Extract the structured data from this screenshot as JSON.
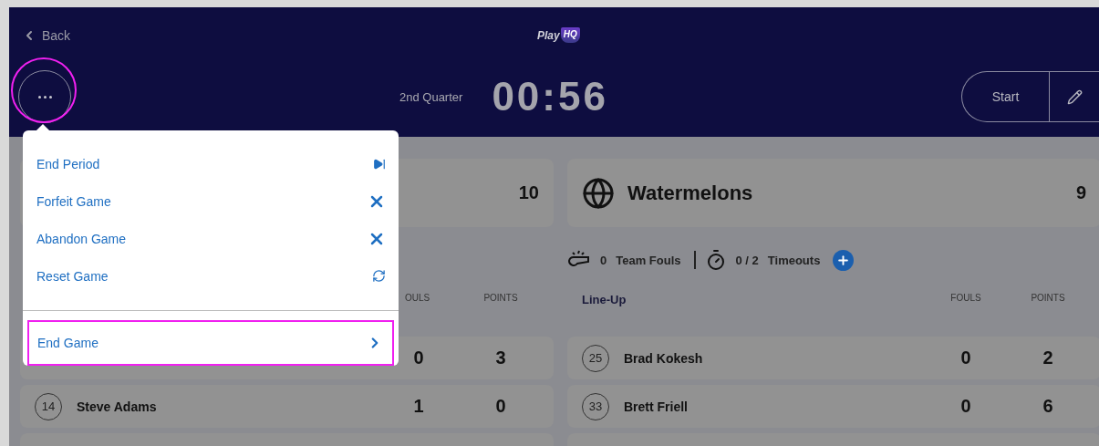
{
  "header": {
    "back": "Back",
    "logo": "Play",
    "logo_badge": "HQ",
    "period": "2nd Quarter",
    "clock": "00:56",
    "start": "Start"
  },
  "menu": {
    "items": [
      {
        "label": "End Period",
        "kind": "skip"
      },
      {
        "label": "Forfeit Game",
        "kind": "close"
      },
      {
        "label": "Abandon Game",
        "kind": "close"
      },
      {
        "label": "Reset Game",
        "kind": "reset"
      }
    ],
    "footer": {
      "label": "End Game",
      "kind": "next"
    }
  },
  "home": {
    "score": "10",
    "columns": [
      "OULS",
      "POINTS"
    ],
    "rows": [
      {
        "fouls": "0",
        "points": "3"
      },
      {
        "number": "14",
        "name": "Steve Adams",
        "fouls": "1",
        "points": "0"
      }
    ]
  },
  "away": {
    "name": "Watermelons",
    "score": "9",
    "fouls": "0",
    "fouls_label": "Team Fouls",
    "timeouts": "0 / 2",
    "timeouts_label": "Timeouts",
    "title": "Line-Up",
    "columns": [
      "FOULS",
      "POINTS"
    ],
    "rows": [
      {
        "number": "25",
        "name": "Brad Kokesh",
        "fouls": "0",
        "points": "2"
      },
      {
        "number": "33",
        "name": "Brett Friell",
        "fouls": "0",
        "points": "6"
      }
    ]
  }
}
